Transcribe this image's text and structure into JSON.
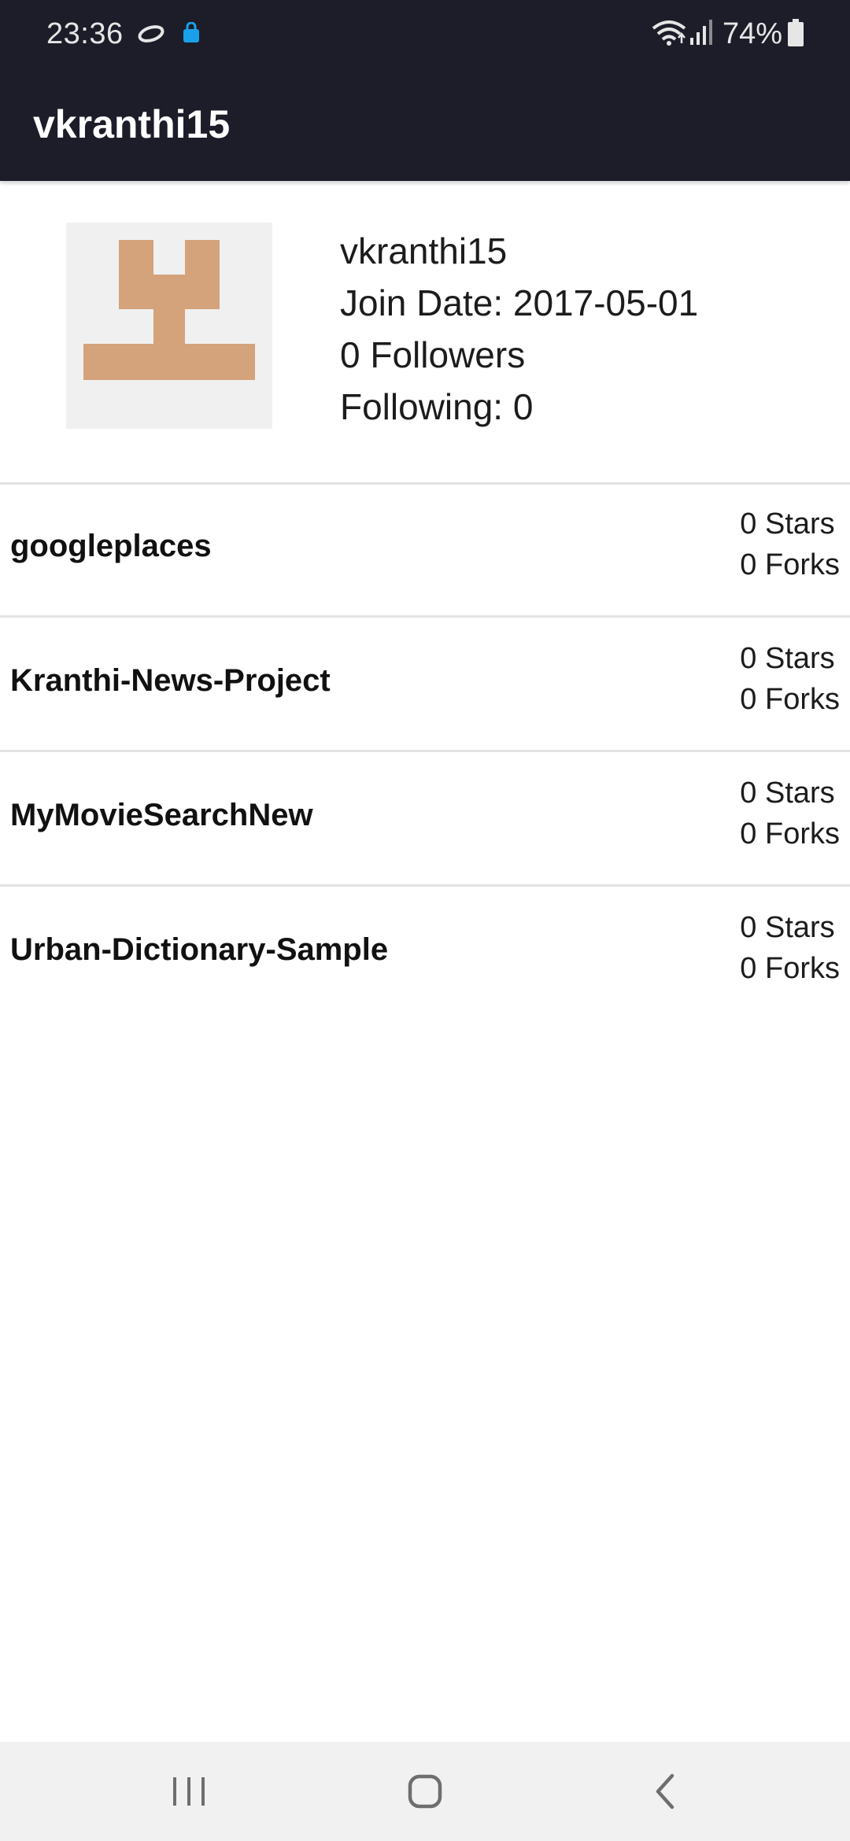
{
  "status_bar": {
    "time": "23:36",
    "battery_percent": "74%",
    "icons": [
      "sync-icon",
      "shopping-bag-icon",
      "wifi-icon",
      "signal-icon",
      "battery-icon"
    ],
    "bag_color": "#1aa0e8"
  },
  "app_bar": {
    "title": "vkranthi15",
    "background": "#1c1d29"
  },
  "profile": {
    "username": "vkranthi15",
    "join_date": "Join Date: 2017-05-01",
    "followers": "0 Followers",
    "following": "Following: 0",
    "avatar_color": "#d4a27b"
  },
  "repositories": [
    {
      "name": "googleplaces",
      "stars": "0 Stars",
      "forks": "0 Forks"
    },
    {
      "name": "Kranthi-News-Project",
      "stars": "0 Stars",
      "forks": "0 Forks"
    },
    {
      "name": "MyMovieSearchNew",
      "stars": "0 Stars",
      "forks": "0 Forks"
    },
    {
      "name": "Urban-Dictionary-Sample",
      "stars": "0 Stars",
      "forks": "0 Forks"
    }
  ],
  "nav_bar": {
    "buttons": [
      "recent-apps-icon",
      "home-icon",
      "back-icon"
    ]
  }
}
